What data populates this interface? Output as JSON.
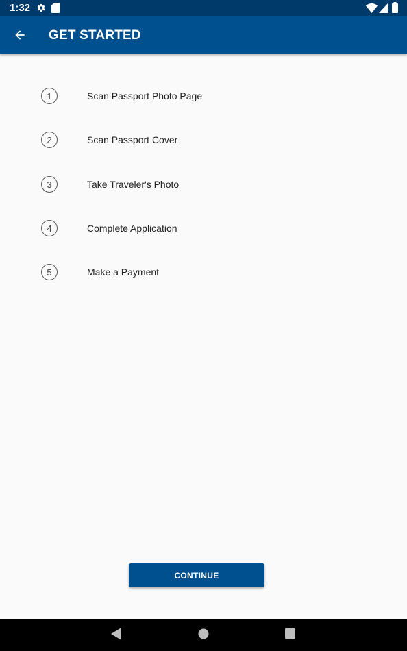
{
  "status_bar": {
    "time": "1:32",
    "icons": [
      "gear-icon",
      "sd-card-icon",
      "wifi-icon",
      "signal-icon",
      "battery-icon"
    ]
  },
  "app_bar": {
    "title": "GET STARTED",
    "back_icon": "arrow-back-icon"
  },
  "steps": [
    {
      "number": "1",
      "label": "Scan Passport Photo Page"
    },
    {
      "number": "2",
      "label": "Scan Passport Cover"
    },
    {
      "number": "3",
      "label": "Take Traveler's Photo"
    },
    {
      "number": "4",
      "label": "Complete Application"
    },
    {
      "number": "5",
      "label": "Make a Payment"
    }
  ],
  "continue_button": {
    "label": "CONTINUE"
  },
  "nav_bar": {
    "icons": [
      "back-triangle-icon",
      "home-circle-icon",
      "recents-square-icon"
    ]
  },
  "colors": {
    "primary": "#00508f",
    "status_bar": "#003a6b",
    "background": "#fafafa"
  }
}
